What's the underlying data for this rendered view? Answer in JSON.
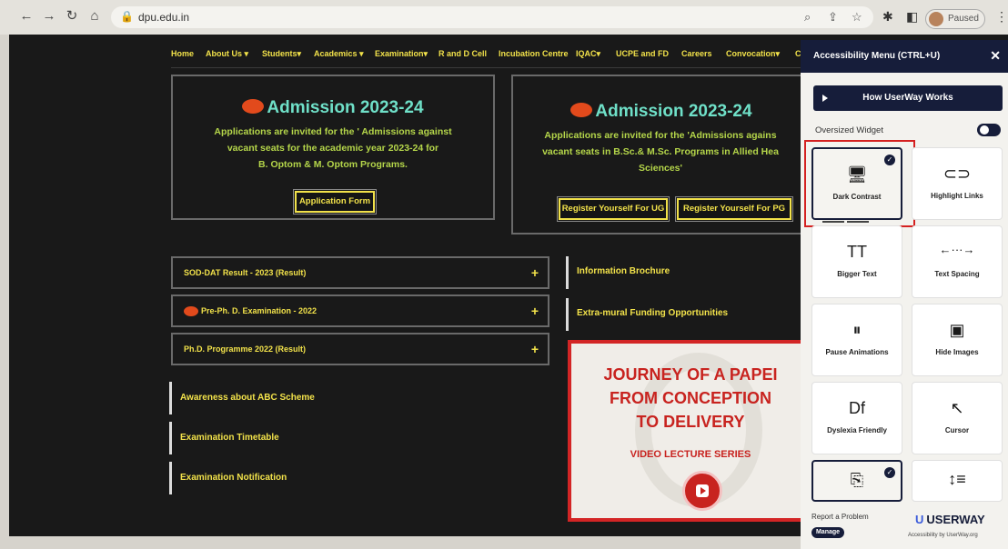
{
  "browser": {
    "url": "dpu.edu.in",
    "profile_status": "Paused"
  },
  "nav": [
    "Home",
    "About Us ▾",
    "Students▾",
    "Academics ▾",
    "Examination▾",
    "R and D Cell",
    "Incubation Centre",
    "IQAC▾",
    "UCPE and FD",
    "Careers",
    "Convocation▾",
    "C"
  ],
  "admission_left": {
    "title": "Admission 2023-24",
    "lines": [
      "Applications are invited for the ' Admissions against",
      "vacant seats for the academic year 2023-24 for",
      "B. Optom & M. Optom Programs."
    ],
    "button": "Application Form"
  },
  "admission_right": {
    "title": "Admission 2023-24",
    "lines": [
      "Applications are invited for the 'Admissions agains",
      "vacant seats in B.Sc.& M.Sc. Programs in Allied Hea",
      "Sciences'"
    ],
    "button_ug": "Register Yourself For UG",
    "button_pg": "Register Yourself For PG"
  },
  "accordion": [
    {
      "label": "SOD-DAT Result - 2023 (Result)",
      "icon": "plus"
    },
    {
      "label": "Pre-Ph. D. Examination - 2022",
      "icon": "plus"
    },
    {
      "label": "Ph.D. Programme 2022 (Result)",
      "icon": "plus"
    }
  ],
  "right_links": [
    "Information Brochure",
    "Extra-mural Funding Opportunities"
  ],
  "left_links": [
    "Awareness about ABC Scheme",
    "Examination Timetable",
    "Examination Notification"
  ],
  "journey": {
    "line1": "JOURNEY OF A PAPEI",
    "line2": "FROM CONCEPTION",
    "line3": "TO DELIVERY",
    "subtitle": "VIDEO LECTURE SERIES"
  },
  "accessibility": {
    "title": "Accessibility Menu (CTRL+U)",
    "how_button": "How UserWay Works",
    "oversized_label": "Oversized Widget",
    "tiles": [
      {
        "label": "Dark Contrast",
        "icon": "monitor-icon",
        "active": true
      },
      {
        "label": "Highlight Links",
        "icon": "link-icon",
        "active": false
      },
      {
        "label": "Bigger Text",
        "icon": "text-size-icon",
        "active": false
      },
      {
        "label": "Text Spacing",
        "icon": "text-spacing-icon",
        "active": false
      },
      {
        "label": "Pause Animations",
        "icon": "pause-icon",
        "active": false
      },
      {
        "label": "Hide Images",
        "icon": "image-icon",
        "active": false
      },
      {
        "label": "Dyslexia Friendly",
        "icon": "dyslexia-icon",
        "active": false
      },
      {
        "label": "Cursor",
        "icon": "cursor-icon",
        "active": false
      }
    ],
    "report": "Report a Problem",
    "manage": "Manage",
    "brand": "USERWAY",
    "brand_sub": "Accessibility by UserWay.org"
  },
  "glyphs": {
    "text_size": "TT",
    "spacing": "←···→",
    "pause": "⏸",
    "dyslexia": "Df",
    "cursor": "↖",
    "line_height": "↕≡"
  }
}
